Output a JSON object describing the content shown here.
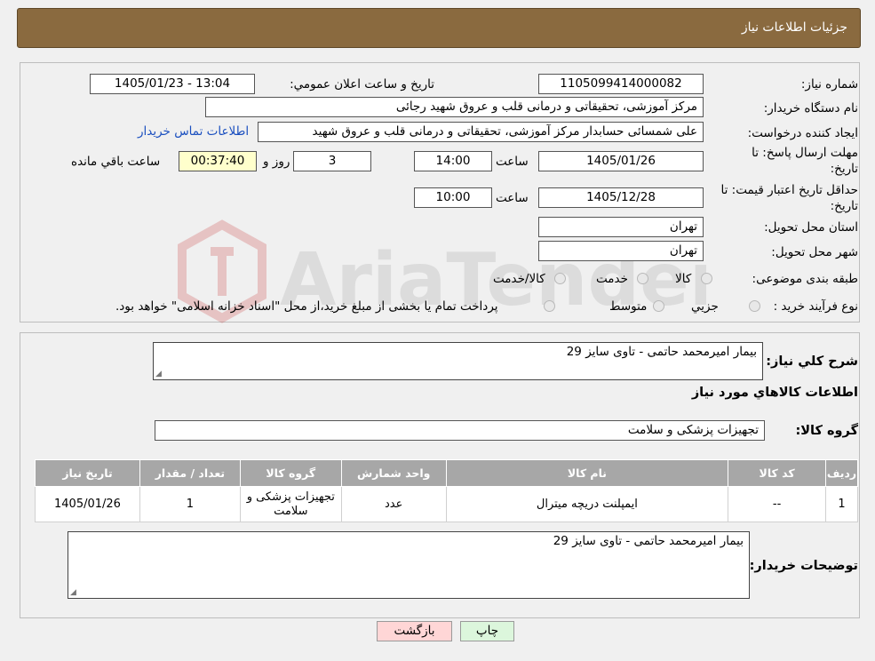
{
  "header": {
    "title": "جزئیات اطلاعات نیاز"
  },
  "watermark": {
    "text": "AriaTender.neT"
  },
  "fields": {
    "need_number_label": "شماره نیاز:",
    "need_number": "1105099414000082",
    "announce_label": "تاريخ و ساعت اعلان عمومي:",
    "announce_value": "1405/01/23 - 13:04",
    "buyer_label": "نام دستگاه خریدار:",
    "buyer_value": "مرکز آموزشی، تحقیقاتی و درمانی قلب و عروق شهید رجائی",
    "requester_label": "ایجاد کننده درخواست:",
    "requester_value": "علی شمسائی حسابدار مرکز آموزشی، تحقیقاتی و درمانی قلب و عروق شهید",
    "contact_link": "اطلاعات تماس خریدار",
    "deadline_label_1": "مهلت ارسال پاسخ: تا",
    "deadline_label_2": "تاریخ:",
    "deadline_date": "1405/01/26",
    "time_label": "ساعت",
    "deadline_time": "14:00",
    "days_value": "3",
    "days_label": "روز و",
    "remaining_time": "00:37:40",
    "remaining_label": "ساعت باقي مانده",
    "validity_label_1": "حداقل تاریخ اعتبار قیمت: تا",
    "validity_label_2": "تاریخ:",
    "validity_date": "1405/12/28",
    "validity_time_label": "ساعت",
    "validity_time": "10:00",
    "province_label": "استان محل تحویل:",
    "province_value": "تهران",
    "city_label": "شهر محل تحویل:",
    "city_value": "تهران",
    "category_label": "طبقه بندی موضوعی:",
    "category_options": [
      "کالا",
      "خدمت",
      "کالا/خدمت"
    ],
    "process_label": "نوع فرآیند خرید :",
    "process_options": [
      "جزیي",
      "متوسط"
    ],
    "process_note": "پرداخت تمام یا بخشی از مبلغ خرید،از محل \"اسناد خزانه اسلامی\" خواهد بود."
  },
  "summary": {
    "label": "شرح کلي نياز:",
    "value": "بیمار امیرمحمد حاتمی - تاوی سایز 29",
    "items_title": "اطلاعات کالاهاي مورد نياز",
    "group_label": "گروه کالا:",
    "group_value": "تجهیزات پزشکی و سلامت"
  },
  "table": {
    "headers": [
      "رديف",
      "کد کالا",
      "نام کالا",
      "واحد شمارش",
      "گروه کالا",
      "تعداد / مقدار",
      "تاريخ نياز"
    ],
    "rows": [
      [
        "1",
        "--",
        "ایمپلنت دریچه میترال",
        "عدد",
        "تجهیزات پزشکی و سلامت",
        "1",
        "1405/01/26"
      ]
    ]
  },
  "buyer_notes": {
    "label": "توضیحات خریدار:",
    "value": "بیمار امیرمحمد حاتمی - تاوی سایز 29"
  },
  "buttons": {
    "back": "بازگشت",
    "print": "چاپ"
  }
}
